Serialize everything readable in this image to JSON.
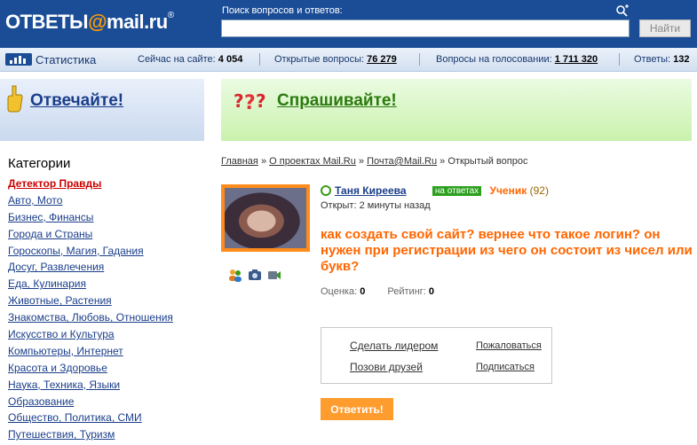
{
  "header": {
    "logo_main": "ОТВЕТЫ",
    "logo_at": "@",
    "logo_domain": "mail.ru",
    "logo_reg": "®",
    "search_label": "Поиск вопросов и ответов:",
    "search_value": "",
    "search_button": "Найти"
  },
  "stats": {
    "title": "Статистика",
    "online_label": "Сейчас на сайте:",
    "online_value": "4 054",
    "open_label": "Открытые вопросы:",
    "open_value": "76 279",
    "voting_label": "Вопросы на голосовании:",
    "voting_value": "1 711 320",
    "answers_label": "Ответы:",
    "answers_value": "132"
  },
  "banners": {
    "answer": "Отвечайте!",
    "ask": "Спрашивайте!"
  },
  "sidebar": {
    "title": "Категории",
    "items": [
      "Детектор Правды",
      "Авто, Мото",
      "Бизнес, Финансы",
      "Города и Страны",
      "Гороскопы, Магия, Гадания",
      "Досуг, Развлечения",
      "Еда, Кулинария",
      "Животные, Растения",
      "Знакомства, Любовь, Отношения",
      "Искусство и Культура",
      "Компьютеры, Интернет",
      "Красота и Здоровье",
      "Наука, Техника, Языки",
      "Образование",
      "Общество, Политика, СМИ",
      "Путешествия, Туризм"
    ]
  },
  "breadcrumb": {
    "home": "Главная",
    "projects": "О проектах Mail.Ru",
    "mail": "Почта@Mail.Ru",
    "current": "Открытый вопрос",
    "sep": "»"
  },
  "question": {
    "user_name": "Таня Киреева",
    "badge": "на ответах",
    "rank": "Ученик",
    "points": "(92)",
    "opened": "Открыт: 2 минуты назад",
    "text": "как создать свой сайт? вернее что такое логин? он нужен при регистрации из чего он состоит из чисел или букв?",
    "rating_label": "Оценка:",
    "rating_value": "0",
    "score_label": "Рейтинг:",
    "score_value": "0"
  },
  "actions": {
    "make_leader": "Сделать лидером",
    "complain": "Пожаловаться",
    "invite": "Позови друзей",
    "subscribe": "Подписаться",
    "answer_button": "Ответить!"
  },
  "icons": {
    "zoom": "zoom-plus-icon",
    "stats": "stats-chart-icon",
    "answer": "thumb-icon",
    "ask": "question-marks-icon",
    "user": "user-status-icon"
  },
  "colors": {
    "header_bg": "#1b4d96",
    "accent_orange": "#ff6600",
    "link_blue": "#1a3e8a",
    "ask_green": "#2c7a10"
  }
}
